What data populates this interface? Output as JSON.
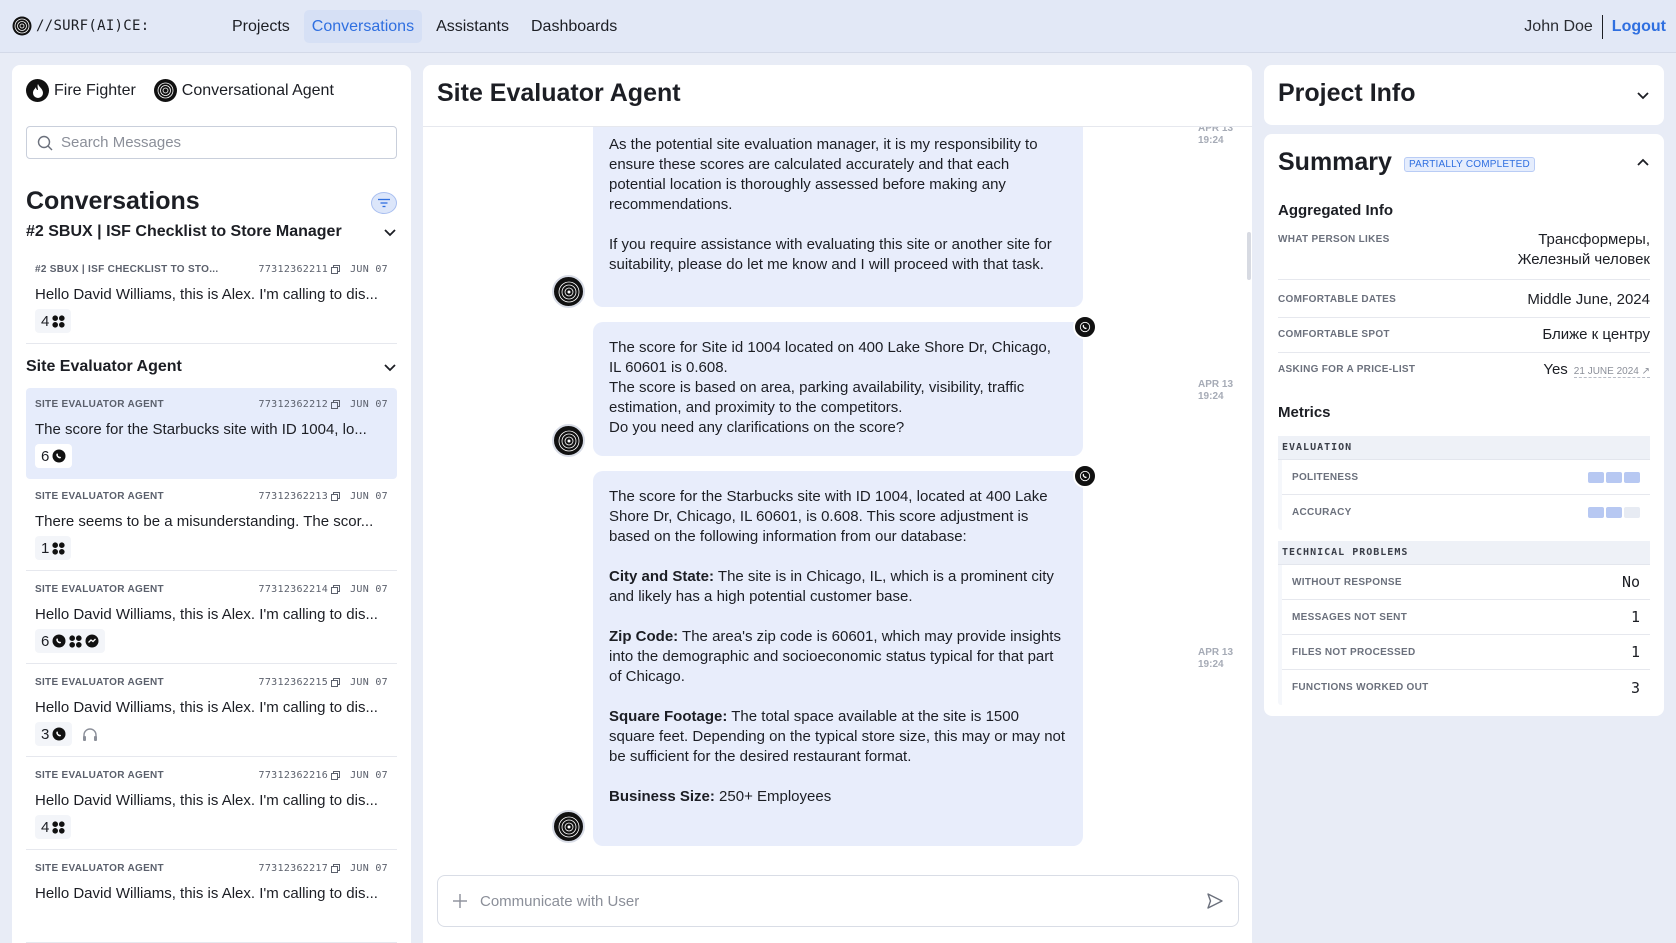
{
  "nav": {
    "logo": "//SURF(AI)CE:",
    "items": [
      "Projects",
      "Conversations",
      "Assistants",
      "Dashboards"
    ],
    "active": 1,
    "user": "John Doe",
    "logout": "Logout"
  },
  "left": {
    "agents": [
      {
        "name": "Fire Fighter",
        "icon": "flame-icon"
      },
      {
        "name": "Conversational Agent",
        "icon": "spiral-icon"
      }
    ],
    "search_placeholder": "Search Messages",
    "title": "Conversations",
    "groups": [
      {
        "name": "#2 SBUX | ISF Checklist to Store Manager",
        "items": [
          {
            "agent": "#2 SBUX | ISF CHECKLIST TO STO...",
            "id": "77312362211",
            "date": "JUN 07",
            "text": "Hello David Williams, this is Alex. I'm calling to dis...",
            "count": "4",
            "icons": [
              "grid-icon"
            ]
          }
        ]
      },
      {
        "name": "Site Evaluator Agent",
        "items": [
          {
            "agent": "SITE EVALUATOR AGENT",
            "id": "77312362212",
            "date": "JUN 07",
            "text": "The score for the Starbucks site with ID 1004, lo...",
            "count": "6",
            "icons": [
              "whatsapp-icon"
            ]
          },
          {
            "agent": "SITE EVALUATOR AGENT",
            "id": "77312362213",
            "date": "JUN 07",
            "text": "There seems to be a misunderstanding. The scor...",
            "count": "1",
            "icons": [
              "grid-icon"
            ]
          },
          {
            "agent": "SITE EVALUATOR AGENT",
            "id": "77312362214",
            "date": "JUN 07",
            "text": "Hello David Williams, this is Alex. I'm calling to dis...",
            "count": "6",
            "icons": [
              "whatsapp-icon",
              "grid-icon",
              "messenger-icon"
            ]
          },
          {
            "agent": "SITE EVALUATOR AGENT",
            "id": "77312362215",
            "date": "JUN 07",
            "text": "Hello David Williams, this is Alex. I'm calling to dis...",
            "count": "3",
            "icons": [
              "whatsapp-icon"
            ],
            "extra": "headset-icon"
          },
          {
            "agent": "SITE EVALUATOR AGENT",
            "id": "77312362216",
            "date": "JUN 07",
            "text": "Hello David Williams, this is Alex. I'm calling to dis...",
            "count": "4",
            "icons": [
              "grid-icon"
            ]
          },
          {
            "agent": "SITE EVALUATOR AGENT",
            "id": "77312362217",
            "date": "JUN 07",
            "text": "Hello David Williams, this is Alex. I'm calling to dis...",
            "count": "",
            "icons": []
          }
        ]
      }
    ]
  },
  "center": {
    "title": "Site Evaluator Agent",
    "messages": [
      {
        "ts_date": "APR 13",
        "ts_time": "19:24",
        "paragraphs": [
          "As the potential site evaluation manager, it is my responsibility to ensure these scores are calculated accurately and that each potential location is thoroughly assessed before making any recommendations.",
          "If you require assistance with evaluating this site or another site for suitability, please do let me know and I will proceed with that task."
        ]
      },
      {
        "ts_date": "APR 13",
        "ts_time": "19:24",
        "lines": [
          "The score for Site id 1004 located on 400 Lake Shore Dr, Chicago, IL 60601 is 0.608.",
          "The score is based on area, parking availability, visibility, traffic estimation, and proximity to the competitors.",
          "Do you need any clarifications on the score?"
        ]
      },
      {
        "ts_date": "APR 13",
        "ts_time": "19:24",
        "intro": "The score for the Starbucks site with ID 1004, located at 400 Lake Shore Dr, Chicago, IL 60601, is 0.608. This score adjustment is based on the following information from our database:",
        "sections": [
          {
            "label": "City and State:",
            "text": " The site is in Chicago, IL, which is a prominent city and likely has a high potential customer base."
          },
          {
            "label": "Zip Code:",
            "text": " The area's zip code is 60601, which may provide insights into the demographic and socioeconomic status typical for that part of Chicago."
          },
          {
            "label": "Square Footage:",
            "text": " The total space available at the site is 1500 square feet. Depending on the typical store size, this may or may not be sufficient for the desired restaurant format."
          },
          {
            "label": "Business Size:",
            "text": " 250+ Employees"
          }
        ]
      }
    ],
    "composer_placeholder": "Communicate with User"
  },
  "right": {
    "project_title": "Project Info",
    "summary_title": "Summary",
    "status": "PARTIALLY COMPLETED",
    "aggregated_title": "Aggregated Info",
    "aggregated": [
      {
        "key": "WHAT PERSON LIKES",
        "value": "Трансформеры, Железный человек"
      },
      {
        "key": "COMFORTABLE DATES",
        "value": "Middle June, 2024"
      },
      {
        "key": "COMFORTABLE SPOT",
        "value": "Ближе к центру"
      },
      {
        "key": "ASKING FOR A PRICE-LIST",
        "value": "Yes",
        "date": "21 JUNE 2024 ↗"
      }
    ],
    "metrics_title": "Metrics",
    "evaluation": {
      "title": "EVALUATION",
      "rows": [
        {
          "key": "POLITENESS",
          "level": 3,
          "max": 3
        },
        {
          "key": "ACCURACY",
          "level": 2,
          "max": 3
        }
      ]
    },
    "technical": {
      "title": "TECHNICAL PROBLEMS",
      "rows": [
        {
          "key": "WITHOUT RESPONSE",
          "value": "No"
        },
        {
          "key": "MESSAGES NOT SENT",
          "value": "1"
        },
        {
          "key": "FILES NOT PROCESSED",
          "value": "1"
        },
        {
          "key": "FUNCTIONS WORKED OUT",
          "value": "3"
        }
      ]
    }
  }
}
